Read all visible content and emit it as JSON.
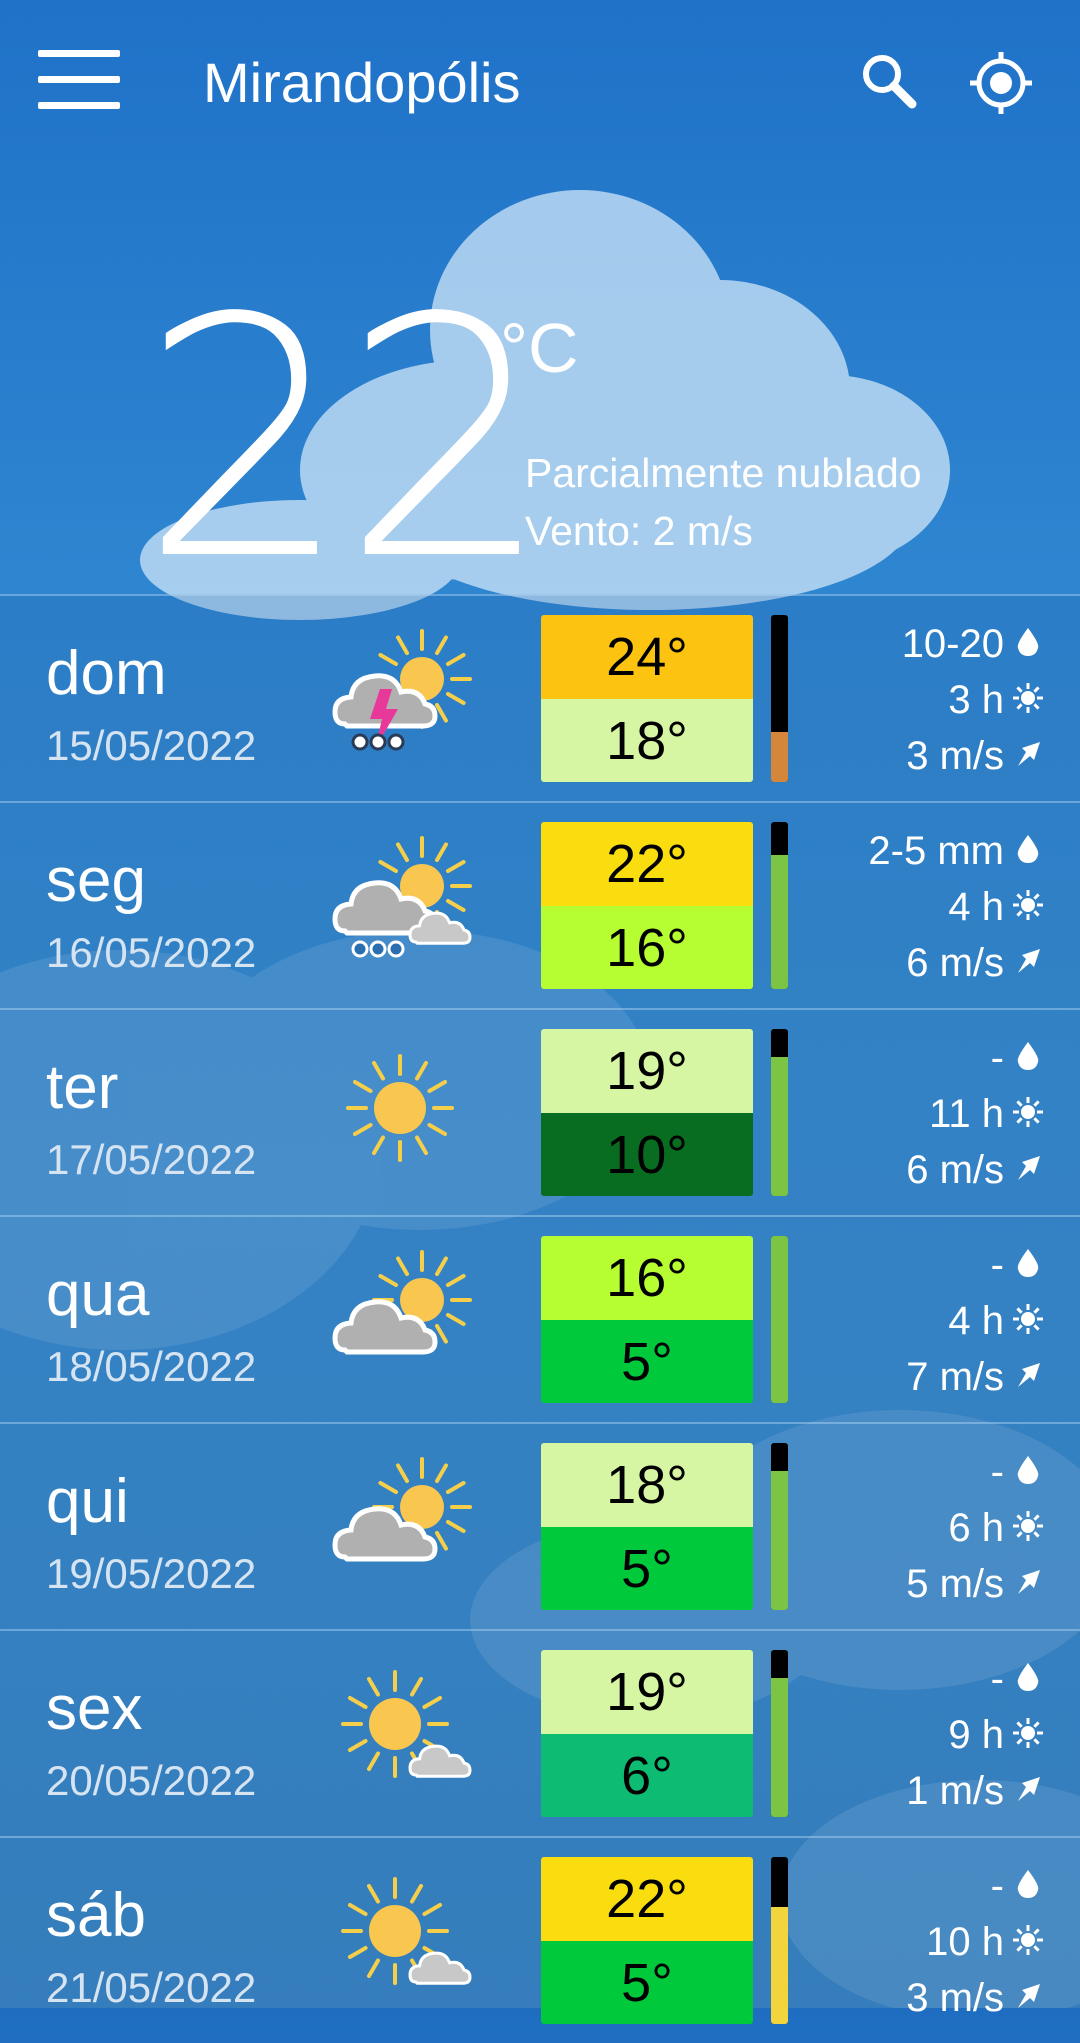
{
  "header": {
    "city": "Mirandopólis",
    "menu_icon": "hamburger-menu-icon",
    "search_icon": "search-icon",
    "locate_icon": "locate-target-icon"
  },
  "current": {
    "temperature": "22",
    "unit": "°C",
    "condition": "Parcialmente nublado",
    "wind": "Vento: 2 m/s"
  },
  "colors": {
    "background": "#2f86d0",
    "bar_black": "#000000",
    "bar_orange": "#d4873b",
    "bar_green": "#7cc443",
    "bar_yellow": "#f2d53c"
  },
  "forecast": [
    {
      "day": "dom",
      "date": "15/05/2022",
      "icon": "thunderstorm-sun-icon",
      "high": "24°",
      "low": "18°",
      "high_color": "#fcc311",
      "low_color": "#d7f6a4",
      "bar_color": "#d4873b",
      "bar_fraction": 0.3,
      "precip": "10-20",
      "sun": "3 h",
      "wind": "3 m/s"
    },
    {
      "day": "seg",
      "date": "16/05/2022",
      "icon": "rain-cloud-sun-icon",
      "high": "22°",
      "low": "16°",
      "high_color": "#f9dd0e",
      "low_color": "#b6fd31",
      "bar_color": "#7cc443",
      "bar_fraction": 0.8,
      "precip": "2-5 mm",
      "sun": "4 h",
      "wind": "6 m/s"
    },
    {
      "day": "ter",
      "date": "17/05/2022",
      "icon": "sun-icon",
      "high": "19°",
      "low": "10°",
      "high_color": "#d7f6a4",
      "low_color": "#086d21",
      "bar_color": "#7cc443",
      "bar_fraction": 0.83,
      "precip": "-",
      "sun": "11 h",
      "wind": "6 m/s"
    },
    {
      "day": "qua",
      "date": "18/05/2022",
      "icon": "cloud-sun-icon",
      "high": "16°",
      "low": "5°",
      "high_color": "#b6fd31",
      "low_color": "#00c93c",
      "bar_color": "#7cc443",
      "bar_fraction": 1.0,
      "precip": "-",
      "sun": "4 h",
      "wind": "7 m/s"
    },
    {
      "day": "qui",
      "date": "19/05/2022",
      "icon": "cloud-sun-icon",
      "high": "18°",
      "low": "5°",
      "high_color": "#d7f6a4",
      "low_color": "#00c93c",
      "bar_color": "#7cc443",
      "bar_fraction": 0.83,
      "precip": "-",
      "sun": "6 h",
      "wind": "5 m/s"
    },
    {
      "day": "sex",
      "date": "20/05/2022",
      "icon": "sun-small-cloud-icon",
      "high": "19°",
      "low": "6°",
      "high_color": "#d7f6a4",
      "low_color": "#0dbb73",
      "bar_color": "#7cc443",
      "bar_fraction": 0.83,
      "precip": "-",
      "sun": "9 h",
      "wind": "1 m/s"
    },
    {
      "day": "sáb",
      "date": "21/05/2022",
      "icon": "sun-small-cloud-icon",
      "high": "22°",
      "low": "5°",
      "high_color": "#f9dd0e",
      "low_color": "#00c93c",
      "bar_color": "#f2d53c",
      "bar_fraction": 0.7,
      "precip": "-",
      "sun": "10 h",
      "wind": "3 m/s"
    }
  ]
}
